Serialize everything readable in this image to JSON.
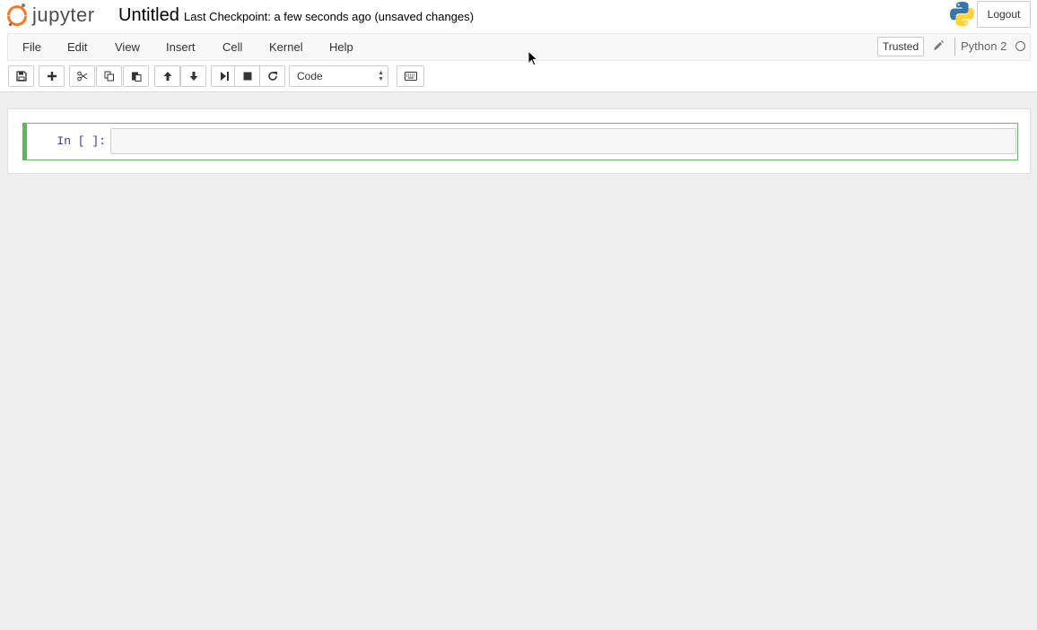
{
  "header": {
    "logo_text": "jupyter",
    "notebook_name": "Untitled",
    "checkpoint": "Last Checkpoint: a few seconds ago (unsaved changes)",
    "logout_label": "Logout"
  },
  "menubar": {
    "items": [
      "File",
      "Edit",
      "View",
      "Insert",
      "Cell",
      "Kernel",
      "Help"
    ],
    "trusted_label": "Trusted",
    "kernel_name": "Python 2"
  },
  "toolbar": {
    "icons": [
      "save-icon",
      "add-cell-icon",
      "cut-icon",
      "copy-icon",
      "paste-icon",
      "move-up-icon",
      "move-down-icon",
      "run-icon",
      "stop-icon",
      "restart-icon",
      "keyboard-icon"
    ],
    "cell_type": "Code"
  },
  "cell": {
    "prompt": "In [ ]:",
    "content": ""
  },
  "colors": {
    "brand": "#f37726",
    "cell_border": "#5cb85c",
    "prompt": "#303f9f",
    "background": "#eeeeee"
  }
}
